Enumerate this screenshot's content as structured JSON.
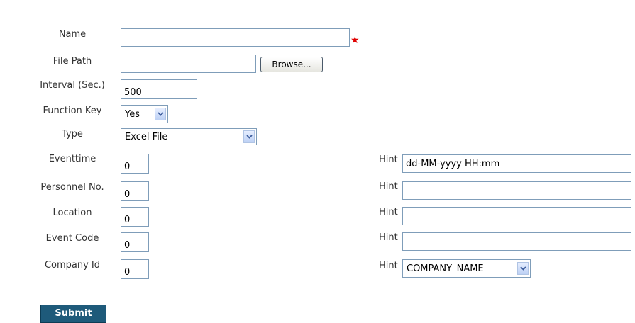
{
  "form": {
    "name": {
      "label": "Name",
      "value": ""
    },
    "file_path": {
      "label": "File Path",
      "value": "",
      "browse_label": "Browse..."
    },
    "interval": {
      "label": "Interval (Sec.)",
      "value": "500"
    },
    "function_key": {
      "label": "Function Key",
      "selected": "Yes"
    },
    "type": {
      "label": "Type",
      "selected": "Excel File"
    },
    "fields": [
      {
        "label": "Eventtime",
        "value": "0",
        "hint_label": "Hint",
        "hint_value": "dd-MM-yyyy HH:mm"
      },
      {
        "label": "Personnel No.",
        "value": "0",
        "hint_label": "Hint",
        "hint_value": ""
      },
      {
        "label": "Location",
        "value": "0",
        "hint_label": "Hint",
        "hint_value": ""
      },
      {
        "label": "Event Code",
        "value": "0",
        "hint_label": "Hint",
        "hint_value": ""
      },
      {
        "label": "Company Id",
        "value": "0",
        "hint_label": "Hint",
        "hint_selected": "COMPANY_NAME"
      }
    ],
    "required_marker": "★",
    "submit_label": "Submit"
  },
  "icons": {
    "dropdown": "chevron-down-icon",
    "required": "star-icon"
  },
  "colors": {
    "submit_bg": "#1e5a7a",
    "required_star": "#e00000",
    "input_border": "#7f9db9"
  }
}
